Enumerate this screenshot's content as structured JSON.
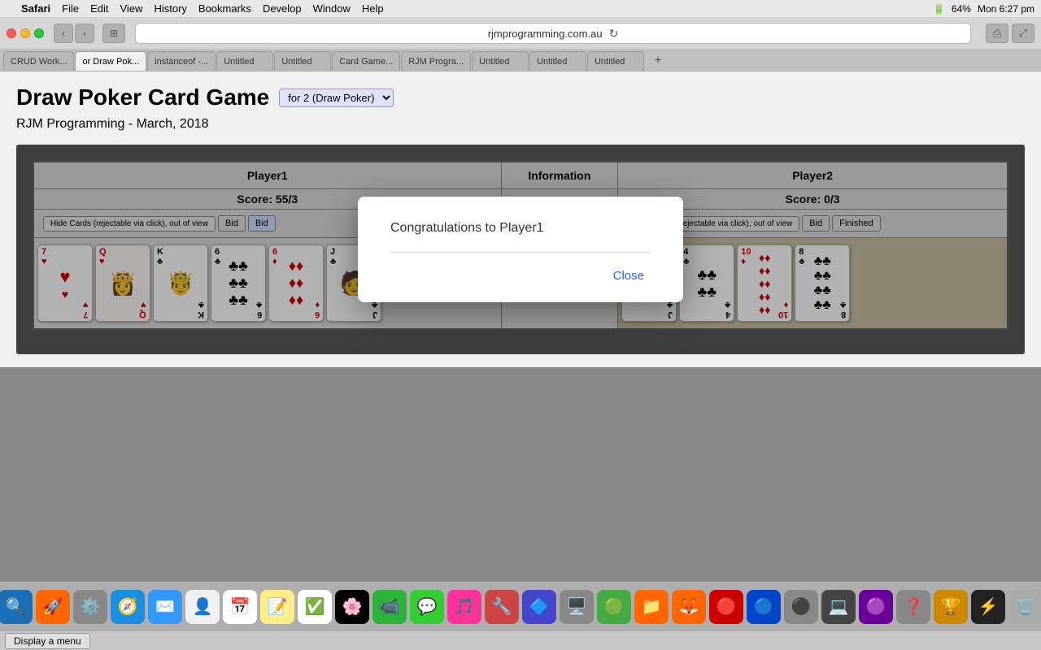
{
  "menubar": {
    "app_name": "Safari",
    "menus": [
      "File",
      "Edit",
      "View",
      "History",
      "Bookmarks",
      "Develop",
      "Window",
      "Help"
    ],
    "clock": "Mon 6:27 pm",
    "battery": "64%"
  },
  "browser": {
    "url": "rjmprogramming.com.au",
    "tabs": [
      {
        "label": "CRUD Work...",
        "active": false
      },
      {
        "label": "or Draw Pok...",
        "active": true
      },
      {
        "label": "instanceof -...",
        "active": false
      },
      {
        "label": "Untitled",
        "active": false
      },
      {
        "label": "Untitled",
        "active": false
      },
      {
        "label": "Card Game...",
        "active": false
      },
      {
        "label": "RJM Progra...",
        "active": false
      },
      {
        "label": "Untitled",
        "active": false
      },
      {
        "label": "Untitled",
        "active": false
      },
      {
        "label": "Untitled",
        "active": false
      }
    ]
  },
  "page": {
    "title": "Draw Poker Card Game",
    "game_selector": "for 2 (Draw Poker)",
    "subtitle": "RJM Programming - March, 2018"
  },
  "game": {
    "player1": {
      "name": "Player1",
      "score": "Score: 55/3"
    },
    "player2": {
      "name": "Player2",
      "score": "Score: 0/3"
    },
    "info_label": "Information",
    "player1_hide_btn": "Hide Cards (rejectable via click), out of view",
    "player1_bid_btn": "Bid",
    "player1_bid_btn2": "Bid",
    "player2_hide_btn": "Hide Cards (rejectable via click), out of view",
    "player2_bid_btn": "Bid",
    "player2_finished_btn": "Finished"
  },
  "modal": {
    "message": "Congratulations to Player1",
    "close_label": "Close"
  },
  "bottom": {
    "display_menu_label": "Display a menu"
  },
  "icons": {
    "back": "‹",
    "forward": "›",
    "reload": "↻",
    "share": "⎙",
    "expand": "⤢",
    "plus": "+"
  }
}
